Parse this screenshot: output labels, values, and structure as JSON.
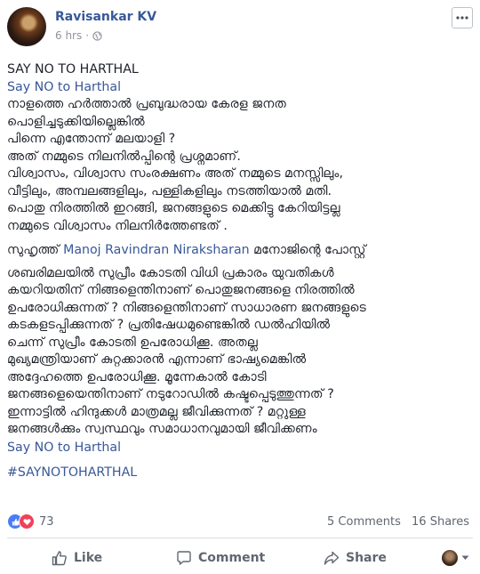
{
  "header": {
    "author": "Ravisankar KV",
    "time": "6 hrs",
    "dot": "·",
    "privacy_icon": "globe-icon",
    "more_icon": "more-options-icon"
  },
  "post": {
    "lines": [
      "SAY NO TO HARTHAL",
      "Say NO to Harthal",
      "നാളത്തെ ഹർത്താൽ പ്രബുദ്ധരായ കേരള ജനത",
      "പൊളിച്ചടുക്കിയില്ലെങ്കിൽ",
      "പിന്നെ എന്തോന്ന് മലയാളി ?",
      "അത് നമ്മുടെ നിലനിൽപ്പിന്റെ പ്രശ്നമാണ്.",
      "വിശ്വാസം, വിശ്വാസ സംരക്ഷണം അത് നമ്മുടെ മനസ്സിലും,",
      "വീട്ടിലും, അമ്പലങ്ങളിലും, പള്ളികളിലും നടത്തിയാൽ മതി.",
      "പൊതു നിരത്തിൽ ഇറങ്ങി, ജനങ്ങളുടെ മെക്കിട്ടു കേറിയിട്ടല്ല",
      "നമ്മുടെ വിശ്വാസം നിലനിർത്തേണ്ടത് ."
    ],
    "share_prefix": "സുഹൃത്ത്",
    "share_name": "Manoj Ravindran Niraksharan",
    "share_suffix": "മനോജിന്റെ പോസ്റ്റ്",
    "quote_lines": [
      "ശബരിമലയിൽ സുപ്രീം കോടതി വിധി പ്രകാരം യുവതികൾ",
      "കയറിയതിന് നിങ്ങളെന്തിനാണ് പൊതുജനങ്ങളെ നിരത്തിൽ",
      "ഉപരോധിക്കുന്നത് ? നിങ്ങളെന്തിനാണ് സാധാരണ ജനങ്ങളുടെ",
      "കടകളടപ്പിക്കുന്നത് ? പ്രതിഷേധമുണ്ടെങ്കിൽ ഡൽഹിയിൽ",
      "ചെന്ന് സുപ്രീം കോടതി ഉപരോധിക്കൂ. അതല്ല",
      "മുഖ്യമന്ത്രിയാണ് കുറ്റക്കാരൻ എന്നാണ് ഭാഷ്യമെങ്കിൽ",
      "അദ്ദേഹത്തെ ഉപരോധിക്കൂ. മൂന്നേകാൽ കോടി",
      "ജനങ്ങളെയെന്തിനാണ് നടുറോഡിൽ കഷ്ടപ്പെടുത്തുന്നത് ?",
      "ഇന്നാട്ടിൽ ഹിന്ദുക്കൾ മാത്രമല്ല ജീവിക്കുന്നത് ? മറ്റുള്ള",
      "ജനങ്ങൾക്കും സ്വസ്ഥവും സമാധാനവുമായി ജീവിക്കണം"
    ],
    "closing": "Say NO to Harthal",
    "hashtag": "#SAYNOTOHARTHAL"
  },
  "stats": {
    "reaction_icons": [
      "like-reaction-icon",
      "love-reaction-icon"
    ],
    "reaction_count": "73",
    "comments": "5 Comments",
    "shares": "16 Shares"
  },
  "actions": {
    "like": "Like",
    "comment": "Comment",
    "share": "Share"
  },
  "colors": {
    "link": "#385898",
    "text": "#1d2129",
    "muted": "#606770",
    "like_blue": "#4a7cf3",
    "love_red": "#f0415a"
  }
}
